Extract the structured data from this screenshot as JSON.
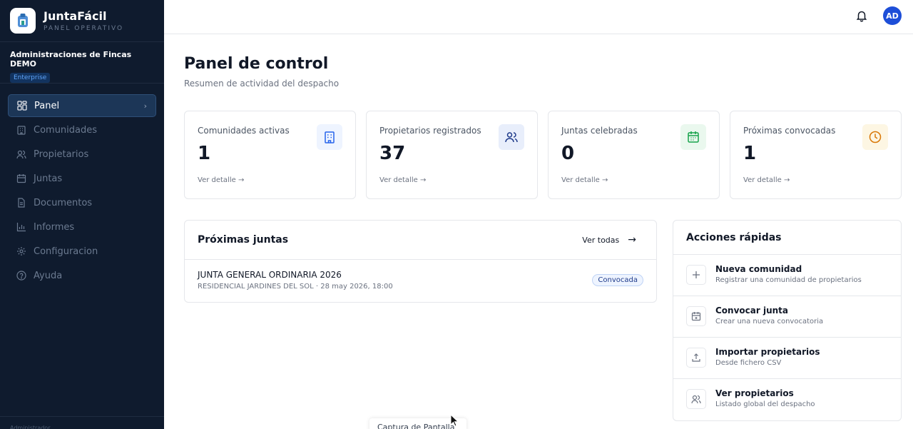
{
  "app": {
    "name": "JuntaFácil",
    "subtitle": "PANEL OPERATIVO"
  },
  "org": {
    "name": "Administraciones de Fincas DEMO",
    "plan": "Enterprise"
  },
  "nav": [
    {
      "label": "Panel",
      "icon": "dashboard-icon",
      "active": true
    },
    {
      "label": "Comunidades",
      "icon": "building-icon"
    },
    {
      "label": "Propietarios",
      "icon": "users-icon"
    },
    {
      "label": "Juntas",
      "icon": "calendar-icon"
    },
    {
      "label": "Documentos",
      "icon": "document-icon"
    },
    {
      "label": "Informes",
      "icon": "bar-chart-icon"
    },
    {
      "label": "Configuracion",
      "icon": "gear-icon"
    },
    {
      "label": "Ayuda",
      "icon": "help-icon"
    }
  ],
  "sidebar_footer": "Administrador",
  "user": {
    "initials": "AD"
  },
  "page": {
    "title": "Panel de control",
    "subtitle": "Resumen de actividad del despacho"
  },
  "stats": [
    {
      "label": "Comunidades activas",
      "value": "1",
      "link": "Ver detalle →",
      "icon": "building-icon",
      "icon_color": "#2563eb",
      "icon_bg": "#eef4ff"
    },
    {
      "label": "Propietarios registrados",
      "value": "37",
      "link": "Ver detalle →",
      "icon": "users-icon",
      "icon_color": "#1e3a8a",
      "icon_bg": "#e8eefb"
    },
    {
      "label": "Juntas celebradas",
      "value": "0",
      "link": "Ver detalle →",
      "icon": "calendar-icon",
      "icon_color": "#16a34a",
      "icon_bg": "#eaf8ee"
    },
    {
      "label": "Próximas convocadas",
      "value": "1",
      "link": "Ver detalle →",
      "icon": "clock-icon",
      "icon_color": "#d97706",
      "icon_bg": "#fdf6e3"
    }
  ],
  "proximas": {
    "title": "Próximas juntas",
    "view_all": "Ver todas",
    "items": [
      {
        "title": "JUNTA GENERAL ORDINARIA 2026",
        "meta": "RESIDENCIAL JARDINES DEL SOL · 28 may 2026, 18:00",
        "status": "Convocada"
      }
    ]
  },
  "acciones": {
    "title": "Acciones rápidas",
    "items": [
      {
        "title": "Nueva comunidad",
        "desc": "Registrar una comunidad de propietarios",
        "icon": "plus-icon"
      },
      {
        "title": "Convocar junta",
        "desc": "Crear una nueva convocatoria",
        "icon": "calendar-plus-icon"
      },
      {
        "title": "Importar propietarios",
        "desc": "Desde fichero CSV",
        "icon": "upload-icon"
      },
      {
        "title": "Ver propietarios",
        "desc": "Listado global del despacho",
        "icon": "users-icon"
      }
    ]
  },
  "toast": "Captura de Pantalla"
}
